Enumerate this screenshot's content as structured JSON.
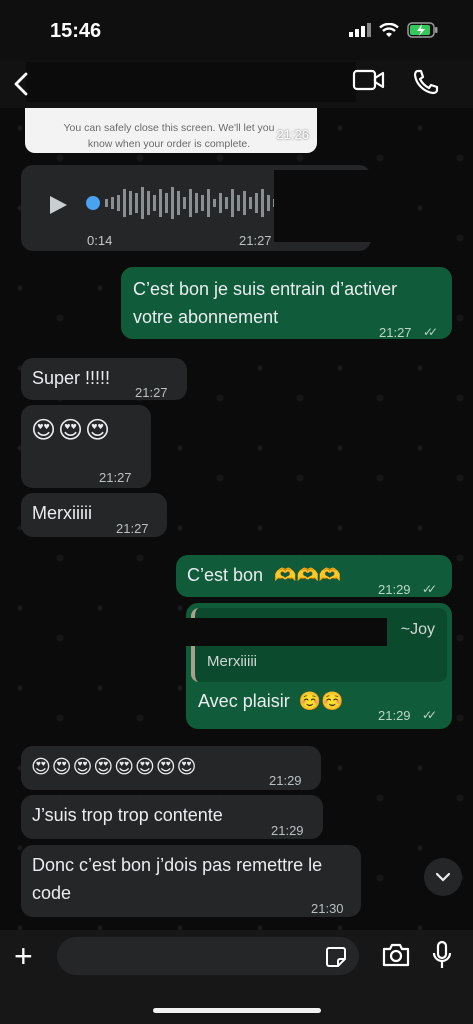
{
  "status": {
    "time": "15:46"
  },
  "header": {
    "back_icon": "chevron-left-icon",
    "video_icon": "video-camera-icon",
    "call_icon": "phone-icon"
  },
  "messages": {
    "order_card": {
      "text": "You can safely close this screen. We'll let you know when your order is complete.",
      "time": "21:26"
    },
    "voice": {
      "duration": "0:14",
      "time": "21:27"
    },
    "out1": {
      "text": "C’est bon je suis entrain d’activer votre abonnement",
      "time": "21:27"
    },
    "in1": {
      "text": "Super !!!!!",
      "time": "21:27"
    },
    "in2": {
      "emoji": "😍😍😍",
      "time": "21:27"
    },
    "in3": {
      "text": "Merxiiiii",
      "time": "21:27"
    },
    "out2": {
      "text": "C’est bon",
      "emoji": "🫶🫶🫶",
      "time": "21:29"
    },
    "out3": {
      "quote_author": "~Joy",
      "quote_text": "Merxiiiii",
      "text": "Avec plaisir",
      "emoji": "☺️☺️",
      "time": "21:29"
    },
    "in4": {
      "emoji": "😍😍😍😍😍😍😍😍",
      "time": "21:29"
    },
    "in5": {
      "text": "J’suis trop trop contente",
      "time": "21:29"
    },
    "in6": {
      "text": "Donc c’est bon j’dois pas remettre le code",
      "time": "21:30"
    }
  },
  "colors": {
    "outgoing": "#105c3a",
    "incoming": "#252627",
    "accent_dot": "#4aa3f0",
    "background": "#0b0b0b"
  }
}
